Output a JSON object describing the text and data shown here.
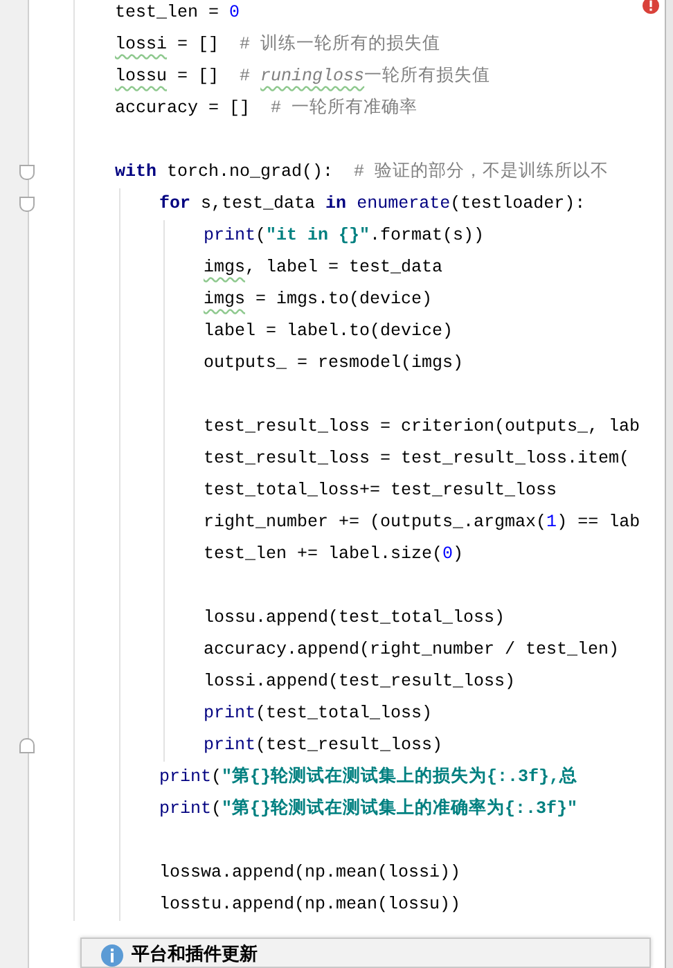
{
  "lines": [
    {
      "kind": "code",
      "tokens": [
        {
          "kind": "plain",
          "text": "test_len = "
        },
        {
          "kind": "number",
          "text": "0"
        }
      ]
    },
    {
      "kind": "code",
      "tokens": [
        {
          "kind": "typo",
          "text": "lossi"
        },
        {
          "kind": "plain",
          "text": " = []  "
        },
        {
          "kind": "comment",
          "text": "# 训练一轮所有的损失值"
        }
      ]
    },
    {
      "kind": "code",
      "tokens": [
        {
          "kind": "typo",
          "text": "lossu"
        },
        {
          "kind": "plain",
          "text": " = []  "
        },
        {
          "kind": "comment",
          "text": "# "
        },
        {
          "kind": "comment-typo",
          "text": "runingloss"
        },
        {
          "kind": "comment",
          "text": "一轮所有损失值"
        }
      ]
    },
    {
      "kind": "code",
      "tokens": [
        {
          "kind": "plain",
          "text": "accuracy = []  "
        },
        {
          "kind": "comment",
          "text": "# 一轮所有准确率"
        }
      ]
    },
    {
      "kind": "blank"
    },
    {
      "kind": "code",
      "tokens": [
        {
          "kind": "keyword",
          "text": "with"
        },
        {
          "kind": "plain",
          "text": " torch.no_grad():  "
        },
        {
          "kind": "comment",
          "text": "# 验证的部分，不是训练所以不"
        }
      ],
      "children": [
        {
          "kind": "code",
          "tokens": [
            {
              "kind": "keyword",
              "text": "for"
            },
            {
              "kind": "plain",
              "text": " s,test_data "
            },
            {
              "kind": "keyword",
              "text": "in"
            },
            {
              "kind": "builtin",
              "text": " enumerate"
            },
            {
              "kind": "plain",
              "text": "(testloader):"
            }
          ],
          "children": [
            {
              "kind": "code",
              "tokens": [
                {
                  "kind": "builtin",
                  "text": "print"
                },
                {
                  "kind": "plain",
                  "text": "("
                },
                {
                  "kind": "string",
                  "text": "\"it in {}\""
                },
                {
                  "kind": "plain",
                  "text": ".format(s))"
                }
              ]
            },
            {
              "kind": "code",
              "tokens": [
                {
                  "kind": "typo",
                  "text": "imgs"
                },
                {
                  "kind": "plain",
                  "text": ", label = test_data"
                }
              ]
            },
            {
              "kind": "code",
              "tokens": [
                {
                  "kind": "typo",
                  "text": "imgs"
                },
                {
                  "kind": "plain",
                  "text": " = imgs.to(device)"
                }
              ]
            },
            {
              "kind": "code",
              "tokens": [
                {
                  "kind": "plain",
                  "text": "label = label.to(device)"
                }
              ]
            },
            {
              "kind": "code",
              "tokens": [
                {
                  "kind": "plain",
                  "text": "outputs_ = resmodel(imgs)"
                }
              ]
            },
            {
              "kind": "blank"
            },
            {
              "kind": "code",
              "tokens": [
                {
                  "kind": "plain",
                  "text": "test_result_loss = criterion(outputs_, lab"
                }
              ]
            },
            {
              "kind": "code",
              "tokens": [
                {
                  "kind": "plain",
                  "text": "test_result_loss = test_result_loss.item("
                }
              ]
            },
            {
              "kind": "code",
              "tokens": [
                {
                  "kind": "plain",
                  "text": "test_total_loss+= test_result_loss"
                }
              ]
            },
            {
              "kind": "code",
              "tokens": [
                {
                  "kind": "plain",
                  "text": "right_number += (outputs_.argmax("
                },
                {
                  "kind": "number",
                  "text": "1"
                },
                {
                  "kind": "plain",
                  "text": ") == lab"
                }
              ]
            },
            {
              "kind": "code",
              "tokens": [
                {
                  "kind": "plain",
                  "text": "test_len += label.size("
                },
                {
                  "kind": "number",
                  "text": "0"
                },
                {
                  "kind": "plain",
                  "text": ")"
                }
              ]
            },
            {
              "kind": "blank"
            },
            {
              "kind": "code",
              "tokens": [
                {
                  "kind": "plain",
                  "text": "lossu.append(test_total_loss)"
                }
              ]
            },
            {
              "kind": "code",
              "tokens": [
                {
                  "kind": "plain",
                  "text": "accuracy.append(right_number / test_len)"
                }
              ]
            },
            {
              "kind": "code",
              "tokens": [
                {
                  "kind": "plain",
                  "text": "lossi.append(test_result_loss)"
                }
              ]
            },
            {
              "kind": "code",
              "tokens": [
                {
                  "kind": "builtin",
                  "text": "print"
                },
                {
                  "kind": "plain",
                  "text": "(test_total_loss)"
                }
              ]
            },
            {
              "kind": "code",
              "tokens": [
                {
                  "kind": "builtin",
                  "text": "print"
                },
                {
                  "kind": "plain",
                  "text": "(test_result_loss)"
                }
              ]
            }
          ]
        },
        {
          "kind": "code",
          "tokens": [
            {
              "kind": "builtin",
              "text": "print"
            },
            {
              "kind": "plain",
              "text": "("
            },
            {
              "kind": "string",
              "text": "\"第{}轮测试在测试集上的损失为{:.3f},总"
            }
          ]
        },
        {
          "kind": "code",
          "tokens": [
            {
              "kind": "builtin",
              "text": "print"
            },
            {
              "kind": "plain",
              "text": "("
            },
            {
              "kind": "string",
              "text": "\"第{}轮测试在测试集上的准确率为{:.3f}\""
            }
          ]
        },
        {
          "kind": "blank"
        },
        {
          "kind": "code",
          "tokens": [
            {
              "kind": "plain",
              "text": "losswa.append(np.mean(lossi))"
            }
          ]
        },
        {
          "kind": "code",
          "tokens": [
            {
              "kind": "plain",
              "text": "losstu.append(np.mean(lossu))"
            }
          ]
        }
      ]
    }
  ],
  "notification": {
    "title": "平台和插件更新"
  }
}
